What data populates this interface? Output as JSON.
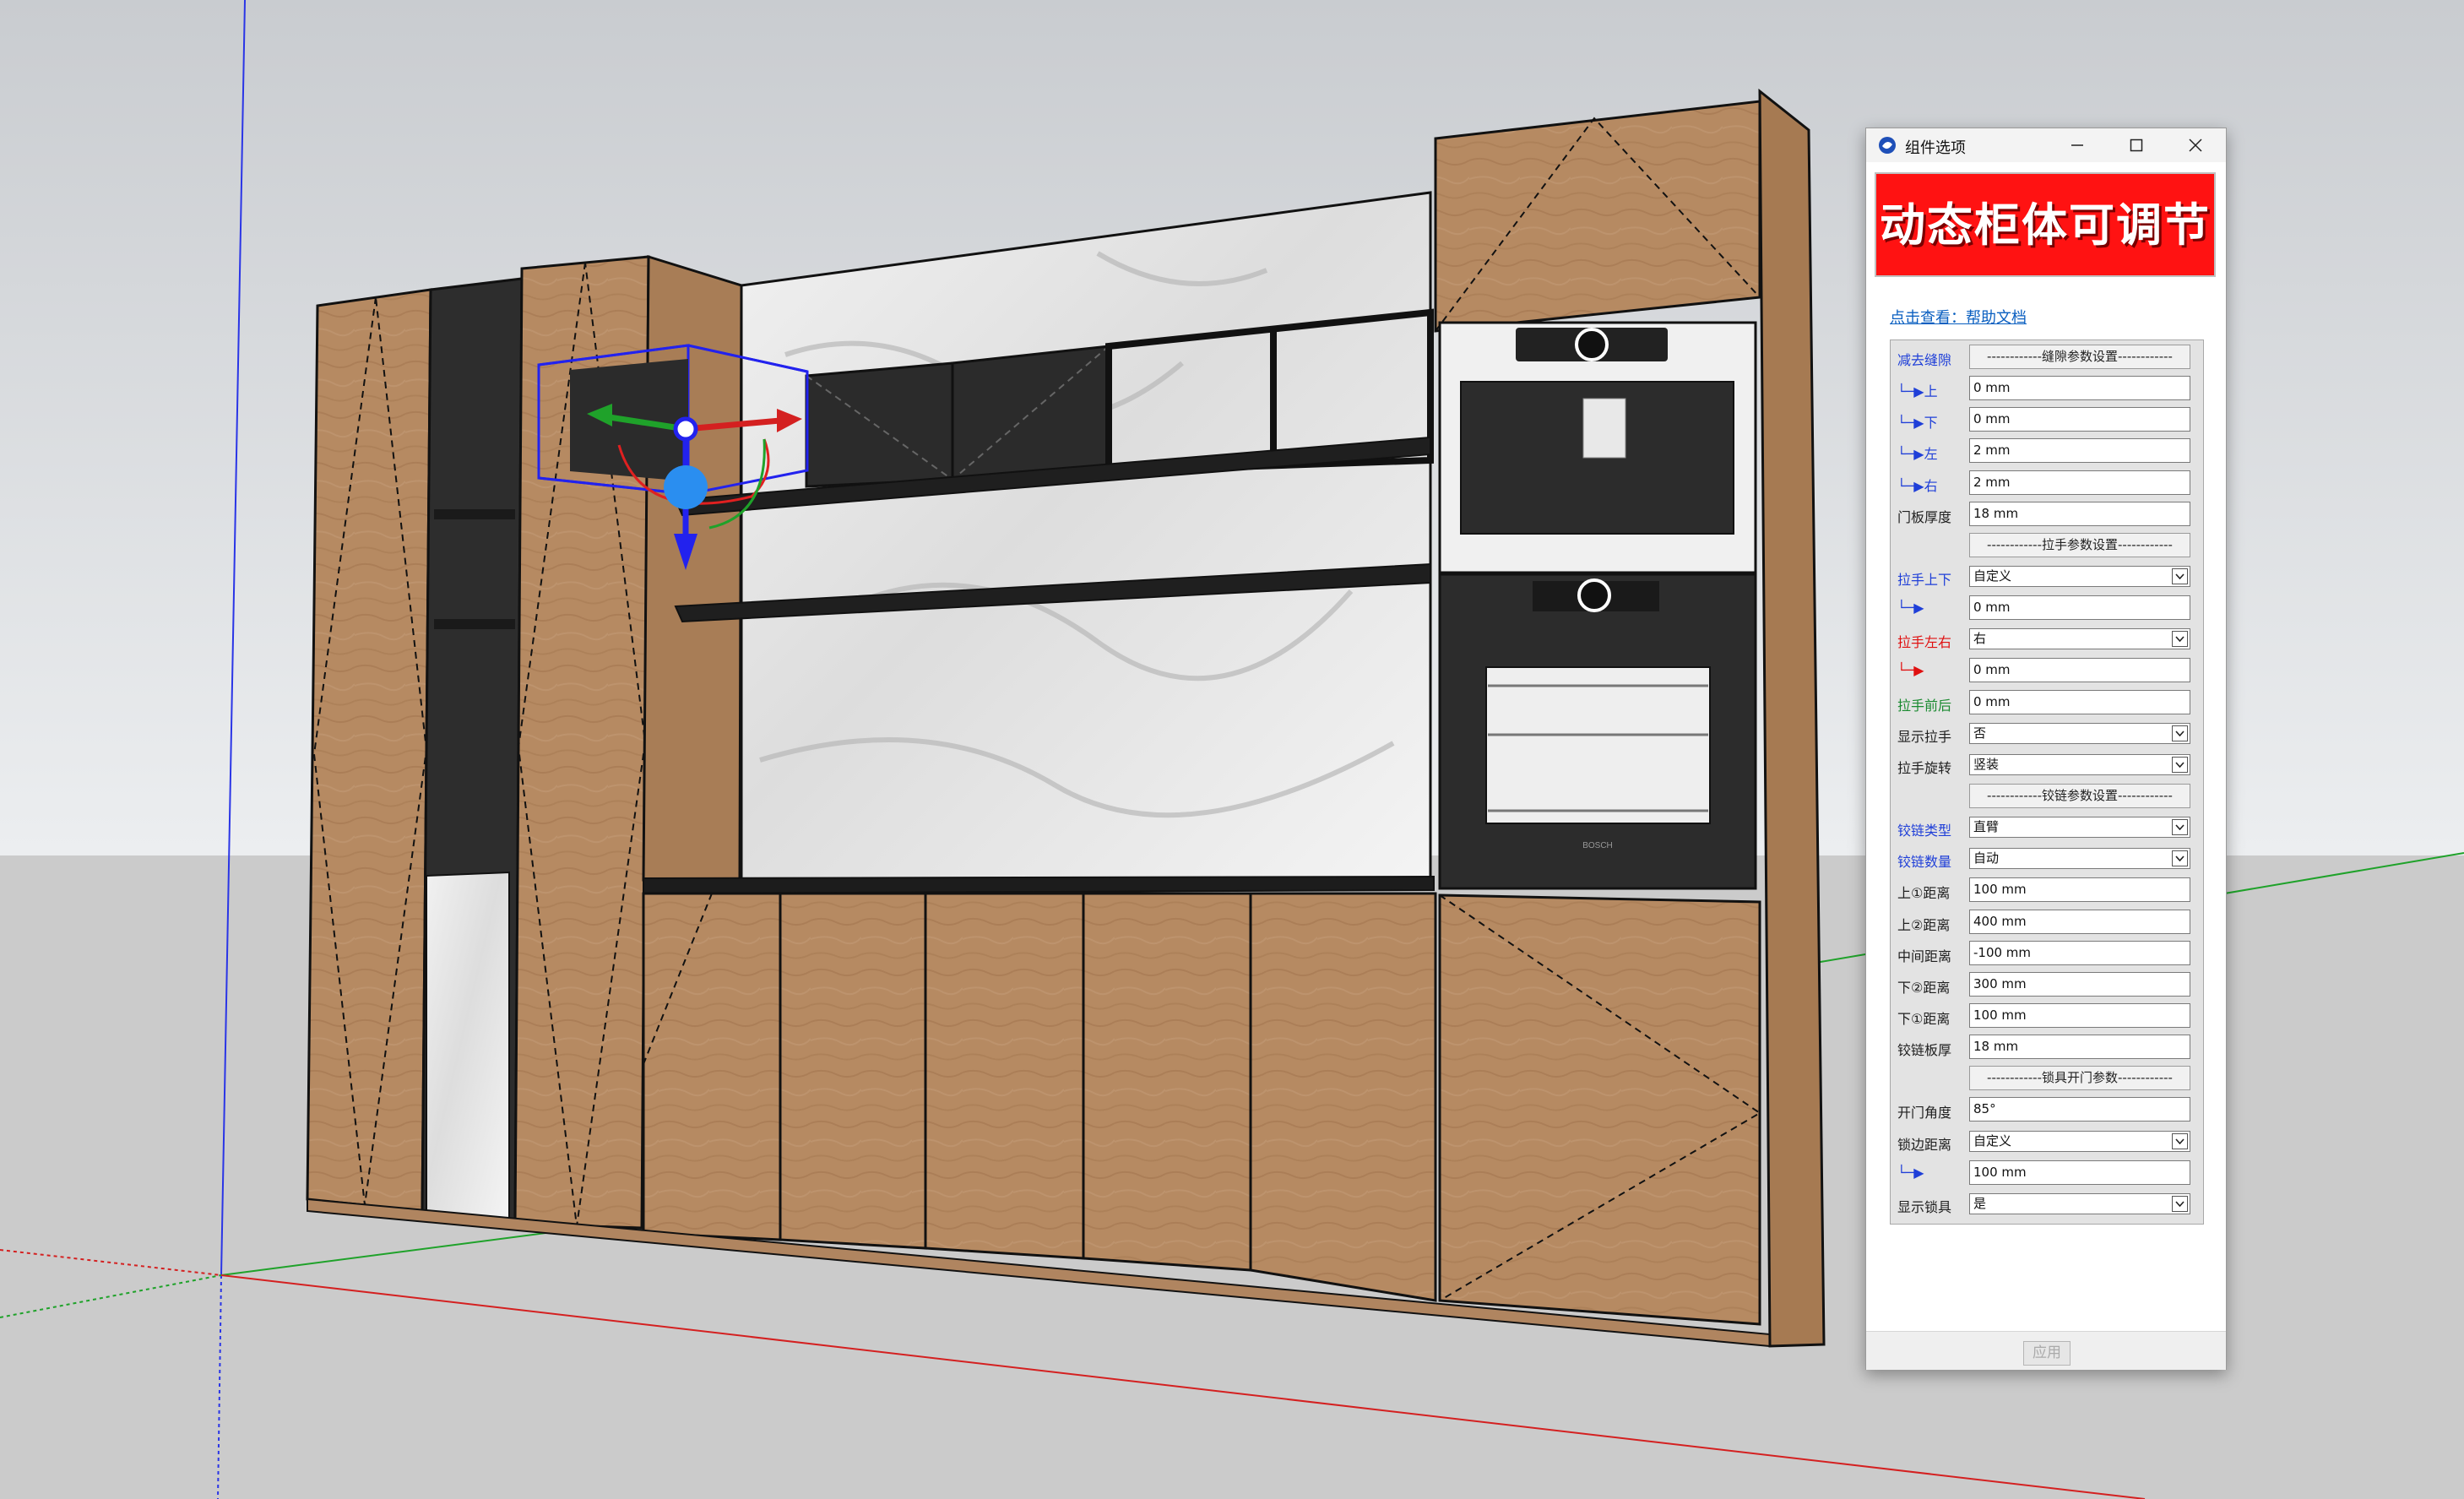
{
  "dialog": {
    "title": "组件选项",
    "banner": "动态柜体可调节",
    "help_link": "点击查看：帮助文档",
    "apply_label": "应用",
    "rows": [
      {
        "label": "减去缝隙",
        "color": "blue",
        "type": "section",
        "value": "------------缝隙参数设置------------"
      },
      {
        "label": "└─▶上",
        "color": "blue",
        "type": "field",
        "value": "0 mm"
      },
      {
        "label": "└─▶下",
        "color": "blue",
        "type": "field",
        "value": "0 mm"
      },
      {
        "label": "└─▶左",
        "color": "blue",
        "type": "field",
        "value": "2 mm"
      },
      {
        "label": "└─▶右",
        "color": "blue",
        "type": "field",
        "value": "2 mm"
      },
      {
        "label": "门板厚度",
        "color": "black",
        "type": "field",
        "value": "18 mm"
      },
      {
        "label": "",
        "color": "black",
        "type": "section",
        "value": "------------拉手参数设置------------"
      },
      {
        "label": "拉手上下",
        "color": "blue",
        "type": "select",
        "value": "自定义"
      },
      {
        "label": "└─▶",
        "color": "blue",
        "type": "field",
        "value": "0 mm"
      },
      {
        "label": "拉手左右",
        "color": "red",
        "type": "select",
        "value": "右"
      },
      {
        "label": "└─▶",
        "color": "red",
        "type": "field",
        "value": "0 mm"
      },
      {
        "label": "拉手前后",
        "color": "green",
        "type": "field",
        "value": "0 mm"
      },
      {
        "label": "显示拉手",
        "color": "black",
        "type": "select",
        "value": "否"
      },
      {
        "label": "拉手旋转",
        "color": "black",
        "type": "select",
        "value": "竖装"
      },
      {
        "label": "",
        "color": "black",
        "type": "section",
        "value": "------------铰链参数设置------------"
      },
      {
        "label": "铰链类型",
        "color": "blue",
        "type": "select",
        "value": "直臂"
      },
      {
        "label": "铰链数量",
        "color": "blue",
        "type": "select",
        "value": "自动"
      },
      {
        "label": "上①距离",
        "color": "black",
        "type": "field",
        "value": "100 mm"
      },
      {
        "label": "上②距离",
        "color": "black",
        "type": "field",
        "value": "400 mm"
      },
      {
        "label": "中间距离",
        "color": "black",
        "type": "field",
        "value": "-100 mm"
      },
      {
        "label": "下②距离",
        "color": "black",
        "type": "field",
        "value": "300 mm"
      },
      {
        "label": "下①距离",
        "color": "black",
        "type": "field",
        "value": "100 mm"
      },
      {
        "label": "铰链板厚",
        "color": "black",
        "type": "field",
        "value": "18 mm"
      },
      {
        "label": "",
        "color": "black",
        "type": "section",
        "value": "------------锁具开门参数------------"
      },
      {
        "label": "开门角度",
        "color": "black",
        "type": "field",
        "value": "85°"
      },
      {
        "label": "锁边距离",
        "color": "black",
        "type": "select",
        "value": "自定义"
      },
      {
        "label": "└─▶",
        "color": "blue",
        "type": "field",
        "value": "100 mm"
      },
      {
        "label": "显示锁具",
        "color": "black",
        "type": "select",
        "value": "是"
      }
    ]
  },
  "appliances": {
    "brand": "BOSCH"
  },
  "icons": [
    "app-icon",
    "minimize-icon",
    "maximize-icon",
    "close-icon",
    "chevron-down-icon",
    "move-gizmo-icon"
  ],
  "colors": {
    "wood": "#b68a62",
    "banner": "#ff1212",
    "link": "#0a5fc0",
    "label_blue": "#1f3fd8",
    "label_red": "#e01010",
    "label_green": "#1a8a30",
    "sky": "#dcdfe3",
    "ground": "#cbcbcb"
  }
}
